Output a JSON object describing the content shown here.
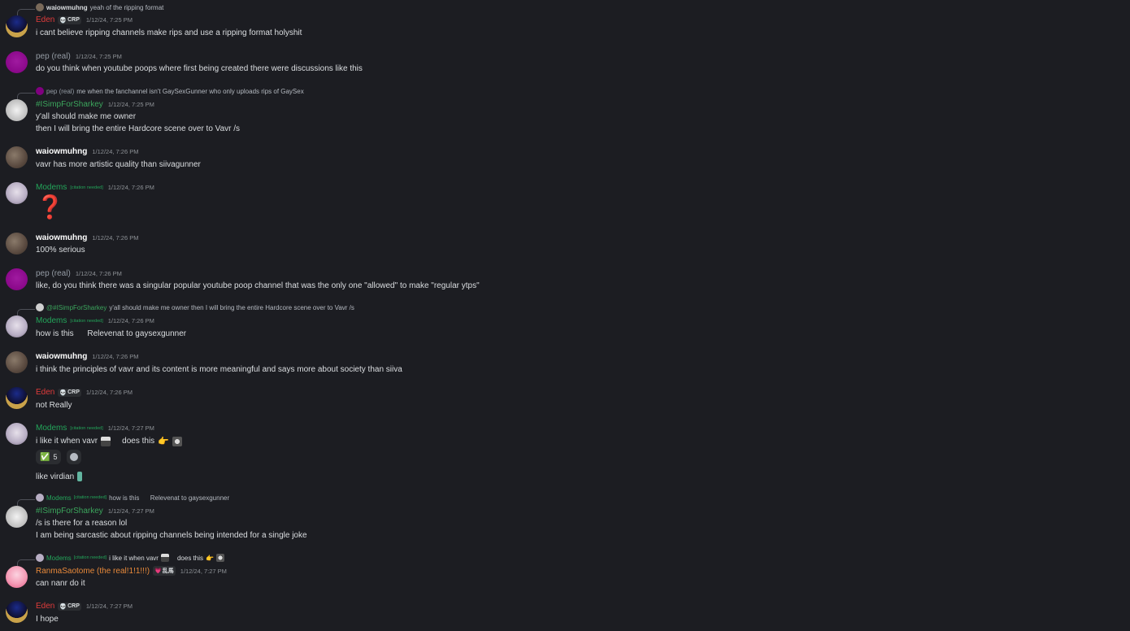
{
  "colors": {
    "eden": "#e03b3b",
    "pep": "#949ba4",
    "modems": "#23a55a",
    "simp": "#3ba55c",
    "ranma": "#e8893a",
    "default": "#ffffff"
  },
  "messages": [
    {
      "reply": {
        "author": "waiowmuhng",
        "text": "yeah of the ripping format"
      },
      "author": "Eden",
      "tag": "CRP",
      "time": "1/12/24, 7:25 PM",
      "lines": [
        "i cant believe ripping channels make rips and use a ripping format holyshit"
      ]
    },
    {
      "author": "pep (real)",
      "time": "1/12/24, 7:25 PM",
      "lines": [
        "do you think when youtube poops where first being created there were discussions like this"
      ]
    },
    {
      "reply": {
        "author": "pep (real)",
        "text": "me when the fanchannel isn't GaySexGunner who only uploads rips of GaySex"
      },
      "author": "#ISimpForSharkey",
      "time": "1/12/24, 7:25 PM",
      "lines": [
        "y'all should make me owner",
        "then I will bring the entire Hardcore scene over to Vavr /s"
      ]
    },
    {
      "author": "waiowmuhng",
      "time": "1/12/24, 7:26 PM",
      "lines": [
        "vavr has more artistic quality than siivagunner"
      ]
    },
    {
      "author": "Modems",
      "badge": "[citation needed]",
      "time": "1/12/24, 7:26 PM",
      "lines": [
        "❓"
      ]
    },
    {
      "author": "waiowmuhng",
      "time": "1/12/24, 7:26 PM",
      "lines": [
        "100% serious"
      ]
    },
    {
      "author": "pep (real)",
      "time": "1/12/24, 7:26 PM",
      "lines": [
        "like, do you think there was a singular popular youtube poop channel that was the  only one \"allowed\" to make \"regular ytps\""
      ]
    },
    {
      "reply": {
        "author": "@#ISimpForSharkey",
        "text": "y'all should make me owner then I will bring the entire Hardcore scene over to Vavr /s"
      },
      "author": "Modems",
      "badge": "[citation needed]",
      "time": "1/12/24, 7:26 PM",
      "lines": [
        "how is this      Relevenat to gaysexgunner"
      ]
    },
    {
      "author": "waiowmuhng",
      "time": "1/12/24, 7:26 PM",
      "lines": [
        "i think the principles of vavr and its content is more meaningful and says more about society than siiva"
      ]
    },
    {
      "author": "Eden",
      "tag": "CRP",
      "time": "1/12/24, 7:26 PM",
      "lines": [
        "not Really"
      ]
    },
    {
      "author": "Modems",
      "badge": "[citation needed]",
      "time": "1/12/24, 7:27 PM",
      "lines": [
        "i like it when vavr",
        "does this",
        "like virdian"
      ],
      "reaction": {
        "emoji": "✅",
        "count": "5"
      }
    },
    {
      "reply": {
        "author": "Modems",
        "badge": "[citation needed]",
        "text": "how is this      Relevenat to gaysexgunner"
      },
      "author": "#ISimpForSharkey",
      "time": "1/12/24, 7:27 PM",
      "lines": [
        "/s is there for a reason lol",
        "I am being sarcastic about ripping channels being intended for a single joke"
      ]
    },
    {
      "reply": {
        "author": "Modems",
        "badge": "[citation needed]",
        "text": "i like it when vavr",
        "text2": "does this"
      },
      "author": "RanmaSaotome (the real!1!1!!!)",
      "tag": "乱馬",
      "time": "1/12/24, 7:27 PM",
      "lines": [
        "can nanr do it"
      ]
    },
    {
      "author": "Eden",
      "tag": "CRP",
      "time": "1/12/24, 7:27 PM",
      "lines": [
        "I hope"
      ]
    }
  ]
}
